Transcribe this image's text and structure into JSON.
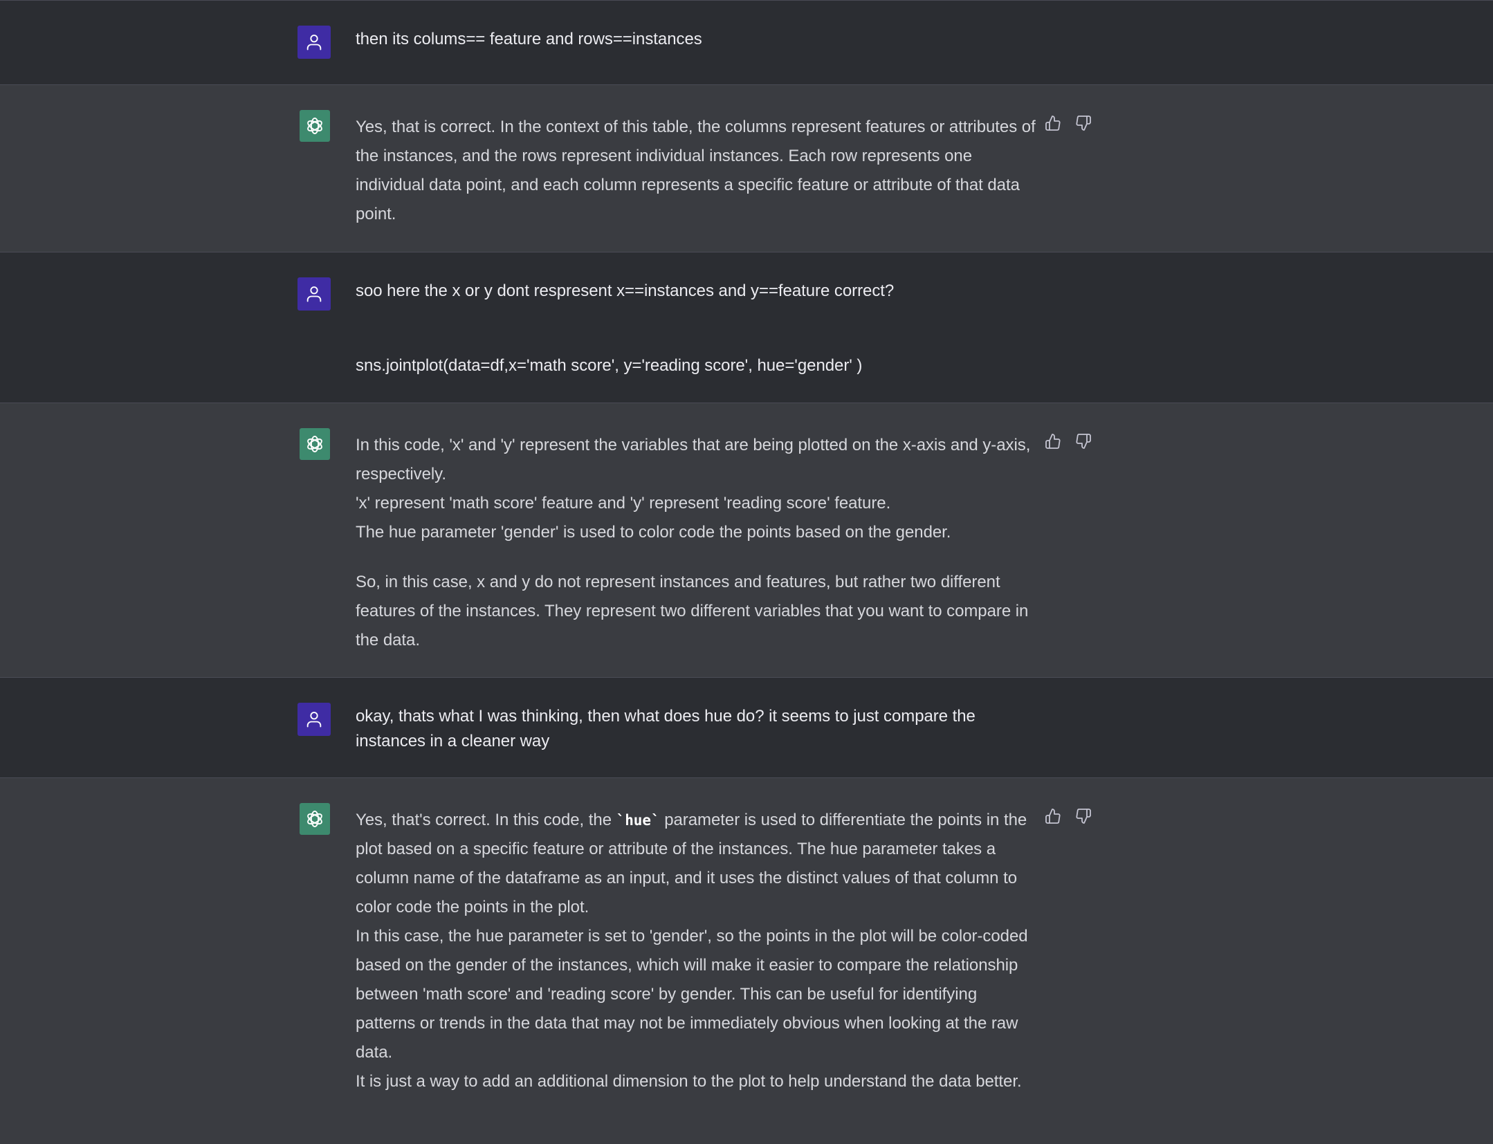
{
  "messages": [
    {
      "role": "user",
      "paragraphs": [
        "then its colums== feature and rows==instances"
      ]
    },
    {
      "role": "assistant",
      "paragraphs": [
        "Yes, that is correct. In the context of this table, the columns represent features or attributes of the instances, and the rows represent individual instances. Each row represents one individual data point, and each column represents a specific feature or attribute of that data point."
      ]
    },
    {
      "role": "user",
      "paragraphs": [
        "soo here the x or y dont respresent x==instances and y==feature correct?",
        "sns.jointplot(data=df,x='math score', y='reading score', hue='gender' )"
      ]
    },
    {
      "role": "assistant",
      "paragraphs": [
        "In this code, 'x' and 'y' represent the variables that are being plotted on the x-axis and y-axis, respectively.",
        "'x' represent 'math score' feature and 'y' represent 'reading score' feature.",
        "The hue parameter 'gender' is used to color code the points based on the gender.",
        "So, in this case, x and y do not represent instances and features, but rather two different features of the instances. They represent two different variables that you want to compare in the data."
      ]
    },
    {
      "role": "user",
      "paragraphs": [
        "okay, thats what I was thinking, then what does hue do? it seems to just compare the instances in a cleaner way"
      ]
    },
    {
      "role": "assistant",
      "p1_before": "Yes, that's correct. In this code, the ",
      "p1_code": "`hue`",
      "p1_after": " parameter is used to differentiate the points in the plot based on a specific feature or attribute of the instances. The hue parameter takes a column name of the dataframe as an input, and it uses the distinct values of that column to color code the points in the plot.",
      "paragraphs": [
        "In this case, the hue parameter is set to 'gender', so the points in the plot will be color-coded based on the gender of the instances, which will make it easier to compare the relationship between 'math score' and 'reading score' by gender. This can be useful for identifying patterns or trends in the data that may not be immediately obvious when looking at the raw data.",
        "It is just a way to add an additional dimension to the plot to help understand the data better."
      ]
    }
  ],
  "colors": {
    "user_bg": "#2b2d32",
    "assistant_bg": "#3a3c41",
    "user_avatar": "#3f2ca4",
    "assistant_avatar": "#3d8a6e"
  },
  "icons": {
    "user_avatar": "user-icon",
    "assistant_avatar": "openai-logo-icon",
    "like": "thumbs-up-icon",
    "dislike": "thumbs-down-icon"
  }
}
